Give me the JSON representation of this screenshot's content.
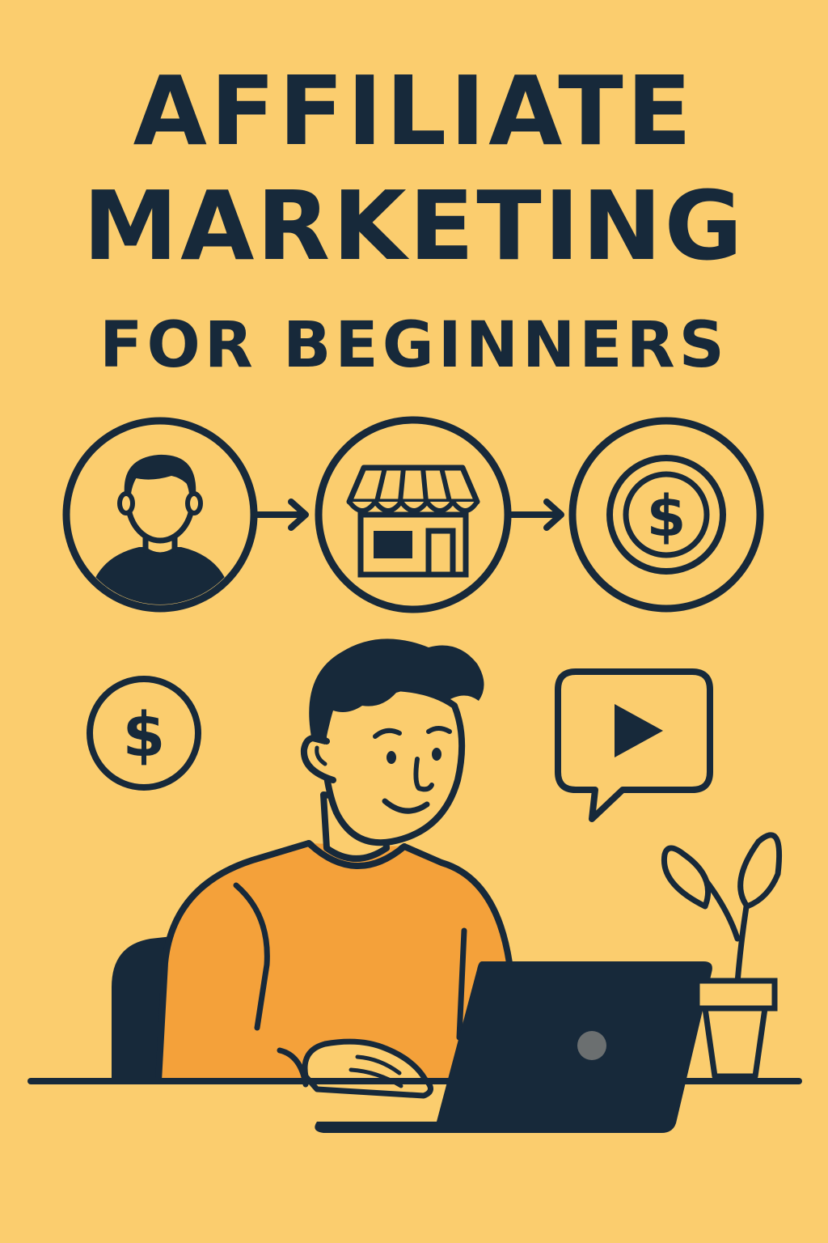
{
  "cover": {
    "title_line1": "AFFILIATE",
    "title_line2": "MARKETING",
    "subtitle": "FOR BEGINNERS"
  },
  "icons": {
    "flow": [
      "user-icon",
      "arrow-right-icon",
      "storefront-icon",
      "arrow-right-icon",
      "coin-dollar-icon"
    ],
    "floating": [
      "dollar-circle-icon",
      "video-play-bubble-icon"
    ],
    "scene": [
      "person-illustration",
      "laptop-icon",
      "potted-plant-icon",
      "chair-icon"
    ],
    "currency_symbol": "$"
  },
  "colors": {
    "background": "#fbcd6e",
    "ink": "#17293a",
    "shirt": "#f4a13a",
    "laptop_logo": "#6b6f70"
  }
}
